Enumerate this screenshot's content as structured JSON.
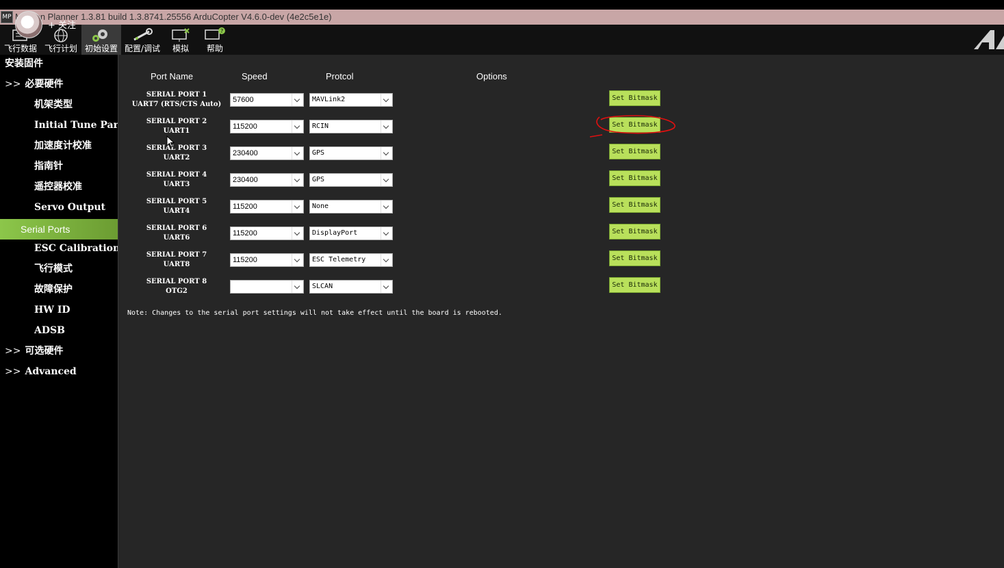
{
  "window": {
    "title": "Mission Planner 1.3.81 build 1.3.8741.25556 ArduCopter V4.6.0-dev (4e2c5e1e)",
    "app_icon": "MP",
    "overlay_follow": "+ 关注"
  },
  "toolbar": {
    "items": [
      {
        "label": "飞行数据",
        "icon": "flight-data-icon"
      },
      {
        "label": "飞行计划",
        "icon": "globe-icon"
      },
      {
        "label": "初始设置",
        "icon": "gears-icon",
        "active": true
      },
      {
        "label": "配置/调试",
        "icon": "wrench-icon"
      },
      {
        "label": "模拟",
        "icon": "simulation-icon"
      },
      {
        "label": "帮助",
        "icon": "help-icon"
      }
    ],
    "brand_logo_icon": "ardupilot-logo-icon"
  },
  "sidebar": {
    "items": [
      {
        "label": "安装固件",
        "level": 0,
        "expander": ""
      },
      {
        "label": "必要硬件",
        "level": 0,
        "expander": ">>"
      },
      {
        "label": "机架类型",
        "level": 1
      },
      {
        "label": "Initial Tune Parameters",
        "level": 1
      },
      {
        "label": "加速度计校准",
        "level": 1
      },
      {
        "label": "指南针",
        "level": 1
      },
      {
        "label": "遥控器校准",
        "level": 1
      },
      {
        "label": "Servo Output",
        "level": 1
      },
      {
        "label": "Serial Ports",
        "level": 1,
        "active": true
      },
      {
        "label": "ESC Calibration",
        "level": 1
      },
      {
        "label": "飞行模式",
        "level": 1
      },
      {
        "label": "故障保护",
        "level": 1
      },
      {
        "label": "HW ID",
        "level": 1
      },
      {
        "label": "ADSB",
        "level": 1
      },
      {
        "label": "可选硬件",
        "level": 0,
        "expander": ">>"
      },
      {
        "label": "Advanced",
        "level": 0,
        "expander": ">>"
      }
    ]
  },
  "serial_ports": {
    "headers": {
      "port_name": "Port Name",
      "speed": "Speed",
      "protocol": "Protcol",
      "options": "Options"
    },
    "button_label": "Set Bitmask",
    "rows": [
      {
        "name": "SERIAL PORT 1",
        "uart": "UART7 (RTS/CTS Auto)",
        "speed": "57600",
        "protocol": "MAVLink2"
      },
      {
        "name": "SERIAL PORT 2",
        "uart": "UART1",
        "speed": "115200",
        "protocol": "RCIN",
        "annotated": true
      },
      {
        "name": "SERIAL PORT 3",
        "uart": "UART2",
        "speed": "230400",
        "protocol": "GPS"
      },
      {
        "name": "SERIAL PORT 4",
        "uart": "UART3",
        "speed": "230400",
        "protocol": "GPS"
      },
      {
        "name": "SERIAL PORT 5",
        "uart": "UART4",
        "speed": "115200",
        "protocol": "None"
      },
      {
        "name": "SERIAL PORT 6",
        "uart": "UART6",
        "speed": "115200",
        "protocol": "DisplayPort"
      },
      {
        "name": "SERIAL PORT 7",
        "uart": "UART8",
        "speed": "115200",
        "protocol": "ESC Telemetry"
      },
      {
        "name": "SERIAL PORT 8",
        "uart": "OTG2",
        "speed": "",
        "protocol": "SLCAN"
      }
    ],
    "note": "Note: Changes to the serial port settings will not take effect until the board is rebooted."
  },
  "colors": {
    "accent_green": "#8cc64a",
    "button_green": "#b9e05b",
    "panel_bg": "#262626",
    "titlebar_bg": "#c8a6a6",
    "annotation_red": "#e01010"
  }
}
